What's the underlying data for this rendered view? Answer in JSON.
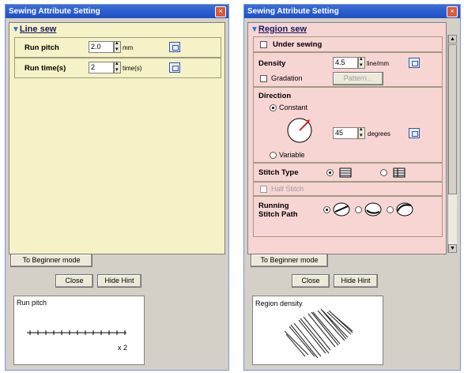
{
  "left": {
    "title": "Sewing Attribute Setting",
    "section": "Line sew",
    "run_pitch": {
      "label": "Run pitch",
      "value": "2.0",
      "unit": "mm"
    },
    "run_times": {
      "label": "Run time(s)",
      "value": "2",
      "unit": "time(s)"
    },
    "beginner_button": "To Beginner mode",
    "close_button": "Close",
    "hide_hint_button": "Hide Hint",
    "hint_title": "Run pitch",
    "hint_multiplier": "x 2"
  },
  "right": {
    "title": "Sewing Attribute Setting",
    "section": "Region sew",
    "under_sewing": "Under sewing",
    "density": {
      "label": "Density",
      "value": "4.5",
      "unit": "line/mm"
    },
    "gradation": "Gradation",
    "pattern_button": "Pattern...",
    "direction_label": "Direction",
    "constant": "Constant",
    "direction_value": "45",
    "direction_unit": "degrees",
    "variable": "Variable",
    "stitch_type": "Stitch Type",
    "half_stitch": "Half Stitch",
    "running_path_line1": "Running",
    "running_path_line2": "Stitch Path",
    "beginner_button": "To Beginner mode",
    "close_button": "Close",
    "hide_hint_button": "Hide Hint",
    "hint_title": "Region density"
  }
}
